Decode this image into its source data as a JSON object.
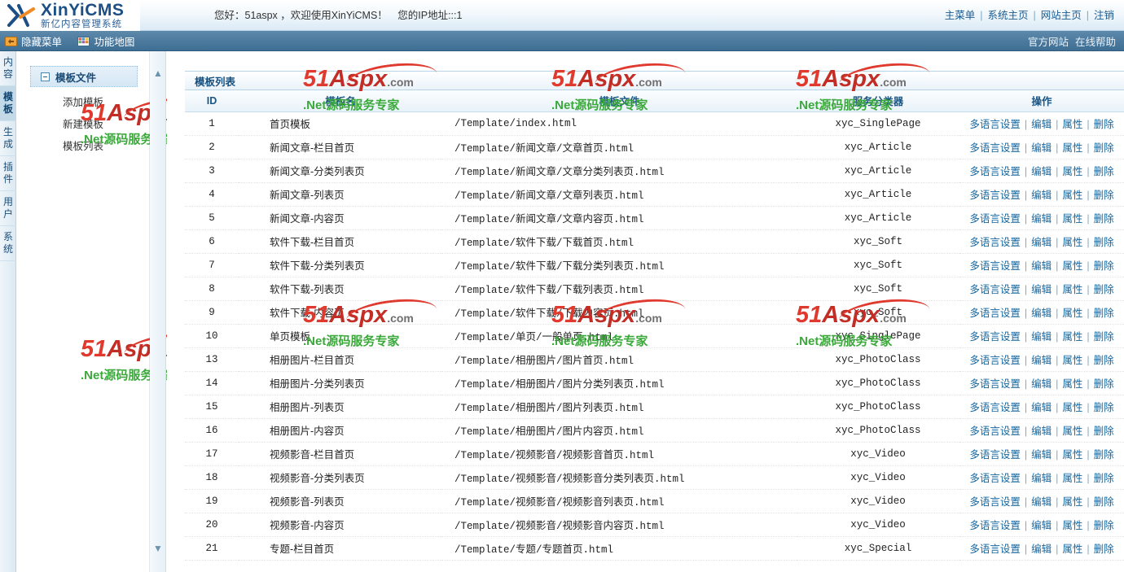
{
  "header": {
    "logo_title": "XinYiCMS",
    "logo_sub": "新亿内容管理系统",
    "greeting": "您好：51aspx ，欢迎使用XinYiCMS！　您的IP地址:::1",
    "links": [
      {
        "label": "主菜单"
      },
      {
        "label": "系统主页"
      },
      {
        "label": "网站主页"
      },
      {
        "label": "注销"
      }
    ],
    "link_separator": "|"
  },
  "menubar": {
    "items": [
      {
        "label": "隐藏菜单",
        "icon": "hide-menu-icon"
      },
      {
        "label": "功能地图",
        "icon": "sitemap-grid-icon"
      }
    ],
    "right_links": [
      {
        "label": "官方网站"
      },
      {
        "label": "在线帮助"
      }
    ]
  },
  "vertical_tabs": [
    {
      "label": "内容",
      "selected": false
    },
    {
      "label": "模板",
      "selected": true
    },
    {
      "label": "生成",
      "selected": false
    },
    {
      "label": "插件",
      "selected": false
    },
    {
      "label": "用户",
      "selected": false
    },
    {
      "label": "系统",
      "selected": false
    }
  ],
  "tree": {
    "root_label": "模板文件",
    "children": [
      {
        "label": "添加模板"
      },
      {
        "label": "新建模板"
      },
      {
        "label": "模板列表"
      }
    ]
  },
  "panel": {
    "title": "模板列表"
  },
  "table": {
    "columns": [
      "ID",
      "模板名",
      "模板文件",
      "服务分类器",
      "操作"
    ],
    "actions": [
      "多语言设置",
      "编辑",
      "属性",
      "删除"
    ],
    "action_separator": "|",
    "rows": [
      {
        "id": "1",
        "name": "首页模板",
        "file": "/Template/index.html",
        "cls": "xyc_SinglePage"
      },
      {
        "id": "2",
        "name": "新闻文章-栏目首页",
        "file": "/Template/新闻文章/文章首页.html",
        "cls": "xyc_Article"
      },
      {
        "id": "3",
        "name": "新闻文章-分类列表页",
        "file": "/Template/新闻文章/文章分类列表页.html",
        "cls": "xyc_Article"
      },
      {
        "id": "4",
        "name": "新闻文章-列表页",
        "file": "/Template/新闻文章/文章列表页.html",
        "cls": "xyc_Article"
      },
      {
        "id": "5",
        "name": "新闻文章-内容页",
        "file": "/Template/新闻文章/文章内容页.html",
        "cls": "xyc_Article"
      },
      {
        "id": "6",
        "name": "软件下载-栏目首页",
        "file": "/Template/软件下载/下载首页.html",
        "cls": "xyc_Soft"
      },
      {
        "id": "7",
        "name": "软件下载-分类列表页",
        "file": "/Template/软件下载/下载分类列表页.html",
        "cls": "xyc_Soft"
      },
      {
        "id": "8",
        "name": "软件下载-列表页",
        "file": "/Template/软件下载/下载列表页.html",
        "cls": "xyc_Soft"
      },
      {
        "id": "9",
        "name": "软件下载-内容页",
        "file": "/Template/软件下载/下载内容页.html",
        "cls": "xyc_Soft"
      },
      {
        "id": "10",
        "name": "单页模板",
        "file": "/Template/单页/一般单页.html",
        "cls": "xyc_SinglePage"
      },
      {
        "id": "13",
        "name": "相册图片-栏目首页",
        "file": "/Template/相册图片/图片首页.html",
        "cls": "xyc_PhotoClass"
      },
      {
        "id": "14",
        "name": "相册图片-分类列表页",
        "file": "/Template/相册图片/图片分类列表页.html",
        "cls": "xyc_PhotoClass"
      },
      {
        "id": "15",
        "name": "相册图片-列表页",
        "file": "/Template/相册图片/图片列表页.html",
        "cls": "xyc_PhotoClass"
      },
      {
        "id": "16",
        "name": "相册图片-内容页",
        "file": "/Template/相册图片/图片内容页.html",
        "cls": "xyc_PhotoClass"
      },
      {
        "id": "17",
        "name": "视频影音-栏目首页",
        "file": "/Template/视频影音/视频影音首页.html",
        "cls": "xyc_Video"
      },
      {
        "id": "18",
        "name": "视频影音-分类列表页",
        "file": "/Template/视频影音/视频影音分类列表页.html",
        "cls": "xyc_Video"
      },
      {
        "id": "19",
        "name": "视频影音-列表页",
        "file": "/Template/视频影音/视频影音列表页.html",
        "cls": "xyc_Video"
      },
      {
        "id": "20",
        "name": "视频影音-内容页",
        "file": "/Template/视频影音/视频影音内容页.html",
        "cls": "xyc_Video"
      },
      {
        "id": "21",
        "name": "专题-栏目首页",
        "file": "/Template/专题/专题首页.html",
        "cls": "xyc_Special"
      }
    ]
  },
  "watermark": {
    "num": "51",
    "word": "Aspx",
    "dotcom": ".com",
    "tagline": ".Net源码服务专家"
  },
  "colors": {
    "brand_blue": "#1b4f86",
    "menubar": "#4d7b9f",
    "link": "#1667a0",
    "watermark_red": "#e03a2f",
    "watermark_green": "#3aa93a"
  }
}
